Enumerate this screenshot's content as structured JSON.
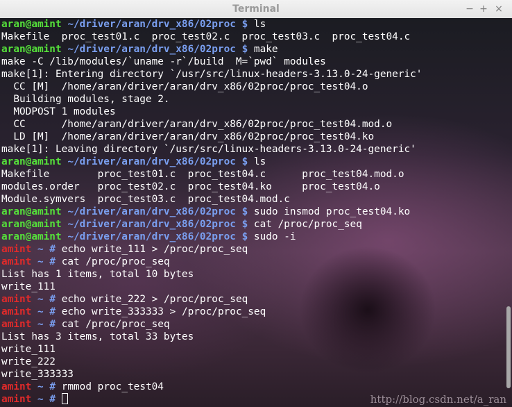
{
  "window": {
    "title": "Terminal",
    "minimize": "−",
    "maximize": "+",
    "close": "×"
  },
  "terminal": {
    "lines": [
      {
        "t": "prompt-user",
        "u": "aran@amint",
        "p": "~/driver/aran/drv_x86/02proc",
        "s": "$",
        "c": "ls"
      },
      {
        "t": "out",
        "text": "Makefile  proc_test01.c  proc_test02.c  proc_test03.c  proc_test04.c"
      },
      {
        "t": "prompt-user",
        "u": "aran@amint",
        "p": "~/driver/aran/drv_x86/02proc",
        "s": "$",
        "c": "make"
      },
      {
        "t": "out",
        "text": "make -C /lib/modules/`uname -r`/build  M=`pwd` modules"
      },
      {
        "t": "out",
        "text": "make[1]: Entering directory `/usr/src/linux-headers-3.13.0-24-generic'"
      },
      {
        "t": "out",
        "text": "  CC [M]  /home/aran/driver/aran/drv_x86/02proc/proc_test04.o"
      },
      {
        "t": "out",
        "text": "  Building modules, stage 2."
      },
      {
        "t": "out",
        "text": "  MODPOST 1 modules"
      },
      {
        "t": "out",
        "text": "  CC      /home/aran/driver/aran/drv_x86/02proc/proc_test04.mod.o"
      },
      {
        "t": "out",
        "text": "  LD [M]  /home/aran/driver/aran/drv_x86/02proc/proc_test04.ko"
      },
      {
        "t": "out",
        "text": "make[1]: Leaving directory `/usr/src/linux-headers-3.13.0-24-generic'"
      },
      {
        "t": "prompt-user",
        "u": "aran@amint",
        "p": "~/driver/aran/drv_x86/02proc",
        "s": "$",
        "c": "ls"
      },
      {
        "t": "out",
        "text": "Makefile        proc_test01.c  proc_test04.c      proc_test04.mod.o"
      },
      {
        "t": "out",
        "text": "modules.order   proc_test02.c  proc_test04.ko     proc_test04.o"
      },
      {
        "t": "out",
        "text": "Module.symvers  proc_test03.c  proc_test04.mod.c"
      },
      {
        "t": "prompt-user",
        "u": "aran@amint",
        "p": "~/driver/aran/drv_x86/02proc",
        "s": "$",
        "c": "sudo insmod proc_test04.ko"
      },
      {
        "t": "prompt-user",
        "u": "aran@amint",
        "p": "~/driver/aran/drv_x86/02proc",
        "s": "$",
        "c": "cat /proc/proc_seq"
      },
      {
        "t": "prompt-user",
        "u": "aran@amint",
        "p": "~/driver/aran/drv_x86/02proc",
        "s": "$",
        "c": "sudo -i"
      },
      {
        "t": "prompt-root",
        "u": "amint",
        "p": "~",
        "s": "#",
        "c": "echo write_111 > /proc/proc_seq"
      },
      {
        "t": "prompt-root",
        "u": "amint",
        "p": "~",
        "s": "#",
        "c": "cat /proc/proc_seq"
      },
      {
        "t": "out",
        "text": "List has 1 items, total 10 bytes"
      },
      {
        "t": "out",
        "text": "write_111"
      },
      {
        "t": "prompt-root",
        "u": "amint",
        "p": "~",
        "s": "#",
        "c": "echo write_222 > /proc/proc_seq"
      },
      {
        "t": "prompt-root",
        "u": "amint",
        "p": "~",
        "s": "#",
        "c": "echo write_333333 > /proc/proc_seq"
      },
      {
        "t": "prompt-root",
        "u": "amint",
        "p": "~",
        "s": "#",
        "c": "cat /proc/proc_seq"
      },
      {
        "t": "out",
        "text": "List has 3 items, total 33 bytes"
      },
      {
        "t": "out",
        "text": "write_111"
      },
      {
        "t": "out",
        "text": "write_222"
      },
      {
        "t": "out",
        "text": "write_333333"
      },
      {
        "t": "prompt-root",
        "u": "amint",
        "p": "~",
        "s": "#",
        "c": "rmmod proc_test04"
      },
      {
        "t": "prompt-root-cursor",
        "u": "amint",
        "p": "~",
        "s": "#",
        "c": ""
      }
    ]
  },
  "watermark": "http://blog.csdn.net/a_ran"
}
